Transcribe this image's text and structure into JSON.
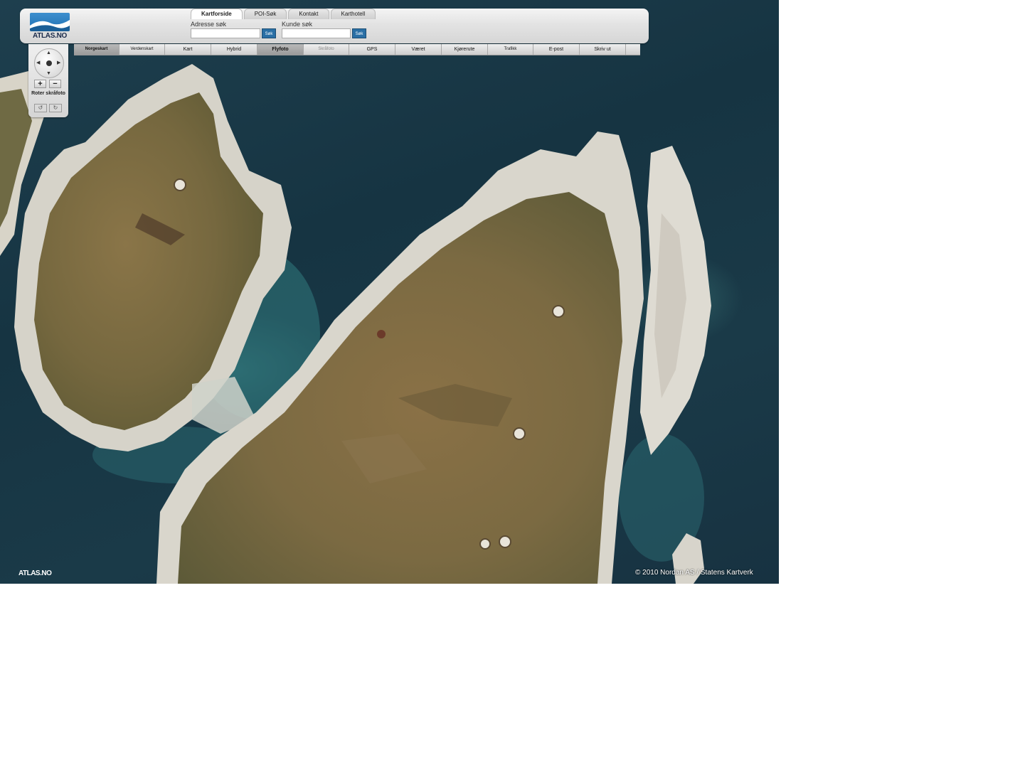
{
  "logo": {
    "text": "ATLAS.NO"
  },
  "tabs": [
    {
      "label": "Kartforside",
      "active": true
    },
    {
      "label": "POI-Søk",
      "active": false
    },
    {
      "label": "Kontakt",
      "active": false
    },
    {
      "label": "Karthotell",
      "active": false
    }
  ],
  "search": {
    "address_label": "Adresse søk",
    "address_value": "",
    "address_button": "Søk",
    "customer_label": "Kunde søk",
    "customer_value": "",
    "customer_button": "Søk"
  },
  "map_types": [
    {
      "label": "Norgeskart",
      "state": "active"
    },
    {
      "label": "Verdenskart",
      "state": "normal"
    },
    {
      "label": "Kart",
      "state": "normal"
    },
    {
      "label": "Hybrid",
      "state": "normal"
    },
    {
      "label": "Flyfoto",
      "state": "active"
    },
    {
      "label": "Skråfoto",
      "state": "disabled"
    },
    {
      "label": "GPS",
      "state": "normal"
    },
    {
      "label": "Været",
      "state": "normal"
    },
    {
      "label": "Kjørerute",
      "state": "normal"
    },
    {
      "label": "Trafikk",
      "state": "normal"
    },
    {
      "label": "E-post",
      "state": "normal"
    },
    {
      "label": "Skriv ut",
      "state": "normal"
    }
  ],
  "nav": {
    "zoom_in": "+",
    "zoom_out": "−",
    "rotate_label": "Roter skråfoto"
  },
  "map": {
    "watermark": "ATLAS.NO",
    "copyright": "© 2010 Nordan AS / Statens Kartverk"
  },
  "colors": {
    "water": "#1a3a48",
    "land": "#7a6a42",
    "rock": "#d8d6cc",
    "accent": "#2a6fa5"
  }
}
